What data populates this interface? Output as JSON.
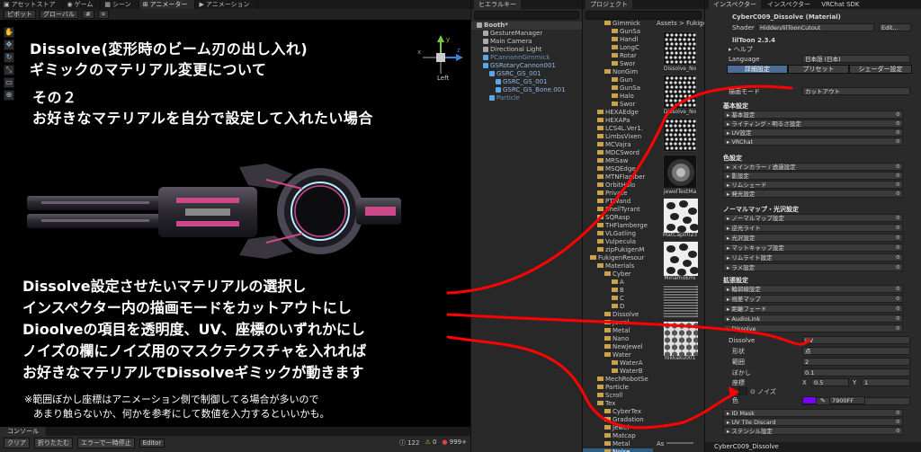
{
  "topbar": {
    "tabs": [
      "アセットストア",
      "ゲーム",
      "シーン",
      "アニメーター",
      "アニメーション"
    ]
  },
  "scene": {
    "toolbar": {
      "pivot": "ピボット",
      "global": "グローバル"
    },
    "gizmo_x": "x",
    "gizmo_y": "y",
    "gizmo_z": "z",
    "gizmo_label": "Left",
    "title_line1": "Dissolve(変形時のビーム刃の出し入れ)",
    "title_line2": "ギミックのマテリアル変更について",
    "part_line1": "その２",
    "part_line2": "お好きなマテリアルを自分で設定して入れたい場合",
    "steps": [
      "Dissolve設定させたいマテリアルの選択し",
      "インスペクター内の描画モードをカットアウトにし",
      "Dioolveの項目を透明度、UV、座標のいずれかにし",
      "ノイズの欄にノイズ用のマスクテクスチャを入れれば",
      "お好きなマテリアルでDissolveギミックが動きます"
    ],
    "note_line1": "※範囲ぼかし座標はアニメーション側で制御してる場合が多いので",
    "note_line2": "あまり触らないか、何かを参考にして数値を入力するといいかも。"
  },
  "console": {
    "tab": "コンソール",
    "clear": "クリア",
    "collapse": "折りたたむ",
    "error_pause": "エラーで一時停止",
    "editor": "Editor",
    "count_info": "122",
    "count_warn": "0",
    "count_error": "999+"
  },
  "hierarchy": {
    "tab": "ヒエラルキー",
    "items": [
      {
        "label": "Booth*",
        "style": "bold",
        "indent": 0
      },
      {
        "label": "GestureManager",
        "style": "normal",
        "indent": 1
      },
      {
        "label": "Main Camera",
        "style": "normal",
        "indent": 1
      },
      {
        "label": "Directional Light",
        "style": "normal",
        "indent": 1
      },
      {
        "label": "PCannonnGimmick",
        "style": "faded",
        "indent": 1
      },
      {
        "label": "GSRotaryCannon001",
        "style": "blue",
        "indent": 1
      },
      {
        "label": "GSRC_GS_001",
        "style": "blue",
        "indent": 2
      },
      {
        "label": "GSRC_GS_001",
        "style": "blue",
        "indent": 3
      },
      {
        "label": "GSRC_GS_Bone.001",
        "style": "blue",
        "indent": 3
      },
      {
        "label": "Particle",
        "style": "faded",
        "indent": 2
      }
    ]
  },
  "project": {
    "tab": "プロジェクト",
    "breadcrumb": "Assets > FukigenR",
    "tree": [
      {
        "label": "Gimmick",
        "indent": 3
      },
      {
        "label": "GunSa",
        "indent": 4
      },
      {
        "label": "Handl",
        "indent": 4
      },
      {
        "label": "LongC",
        "indent": 4
      },
      {
        "label": "Rotar",
        "indent": 4
      },
      {
        "label": "Swor",
        "indent": 4
      },
      {
        "label": "NonGim",
        "indent": 3
      },
      {
        "label": "Gun",
        "indent": 4
      },
      {
        "label": "GunSa",
        "indent": 4
      },
      {
        "label": "Halo",
        "indent": 4
      },
      {
        "label": "Swor",
        "indent": 4
      },
      {
        "label": "HEXAEdge",
        "indent": 2
      },
      {
        "label": "HEXAPa",
        "indent": 2
      },
      {
        "label": "LCS4L.Ver1.",
        "indent": 2
      },
      {
        "label": "LimbsVixen",
        "indent": 2
      },
      {
        "label": "MCVajra",
        "indent": 2
      },
      {
        "label": "MDCSword",
        "indent": 2
      },
      {
        "label": "MRSaw",
        "indent": 2
      },
      {
        "label": "MSQEdge",
        "indent": 2
      },
      {
        "label": "MTNFlamber",
        "indent": 2
      },
      {
        "label": "OrbitHalo",
        "indent": 2
      },
      {
        "label": "Private",
        "indent": 2
      },
      {
        "label": "PTWand",
        "indent": 2
      },
      {
        "label": "ShellTyrant",
        "indent": 2
      },
      {
        "label": "SQRasp",
        "indent": 2
      },
      {
        "label": "THFlamberge",
        "indent": 2
      },
      {
        "label": "VLGatling",
        "indent": 2
      },
      {
        "label": "Vulpecula",
        "indent": 2
      },
      {
        "label": "zipFukigenM",
        "indent": 2
      },
      {
        "label": "FukigenResour",
        "indent": 1
      },
      {
        "label": "Materials",
        "indent": 2
      },
      {
        "label": "Cyber",
        "indent": 3
      },
      {
        "label": "A",
        "indent": 4
      },
      {
        "label": "B",
        "indent": 4
      },
      {
        "label": "C",
        "indent": 4
      },
      {
        "label": "D",
        "indent": 4
      },
      {
        "label": "Dissolve",
        "indent": 3
      },
      {
        "label": "Jewel",
        "indent": 3
      },
      {
        "label": "Metal",
        "indent": 3
      },
      {
        "label": "Nano",
        "indent": 3
      },
      {
        "label": "NewJewel",
        "indent": 3
      },
      {
        "label": "Water",
        "indent": 3
      },
      {
        "label": "WaterA",
        "indent": 4
      },
      {
        "label": "WaterB",
        "indent": 4
      },
      {
        "label": "MechRobotSe",
        "indent": 2
      },
      {
        "label": "Particle",
        "indent": 2
      },
      {
        "label": "Scroll",
        "indent": 2
      },
      {
        "label": "Tex",
        "indent": 2
      },
      {
        "label": "CyberTex",
        "indent": 3
      },
      {
        "label": "Gradation",
        "indent": 3
      },
      {
        "label": "Jewel",
        "indent": 3
      },
      {
        "label": "Matcap",
        "indent": 3
      },
      {
        "label": "Metal",
        "indent": 3
      },
      {
        "label": "Noise",
        "indent": 3,
        "selected": true
      },
      {
        "label": "WaterTex",
        "indent": 3
      },
      {
        "label": "Trail",
        "indent": 2
      }
    ],
    "assets": [
      {
        "label": "Dissolve_No",
        "pattern": "dots"
      },
      {
        "label": "Dissolve_No",
        "pattern": "dots"
      },
      {
        "label": "",
        "pattern": "dots"
      },
      {
        "label": "jewelTestMa",
        "pattern": "swirl"
      },
      {
        "label": "MatCap0023",
        "pattern": "cells"
      },
      {
        "label": "MinamoEmi",
        "pattern": "cells"
      },
      {
        "label": "",
        "pattern": "lines"
      },
      {
        "label": "rokkaku001",
        "pattern": "hex"
      }
    ],
    "slider_label": "As"
  },
  "inspector": {
    "tabs": [
      "インスペクター",
      "インスペクター",
      "VRChat SDK"
    ],
    "material_name": "CyberC009_Dissolve (Material)",
    "shader_label": "Shader",
    "shader_value": "Hidden/lilToonCutout",
    "edit_label": "Edit...",
    "liltoon_version": "lilToon 2.3.4",
    "help": "ヘルプ",
    "language_label": "Language",
    "language_value": "日本語 (日本)",
    "mode_buttons": [
      "詳細設定",
      "プリセット",
      "シェーダー設定"
    ],
    "render_mode_label": "描画モード",
    "render_mode_value": "カットアウト",
    "section_basic": "基本設定",
    "basic_items": [
      "基本設定",
      "ライティング・明るさ設定",
      "UV設定",
      "VRChat"
    ],
    "section_color": "色設定",
    "color_items": [
      "メインカラー / 透過設定",
      "影設定",
      "リムシェード",
      "発光設定"
    ],
    "section_normal": "ノーマルマップ・光沢設定",
    "normal_items": [
      "ノーマルマップ設定",
      "逆光ライト",
      "光沢設定",
      "マットキャップ設定",
      "リムライト設定",
      "ラメ設定"
    ],
    "section_ext": "拡張設定",
    "ext_items": [
      "輪郭線設定",
      "視差マップ",
      "距離フェード",
      "AudioLink",
      "Dissolve"
    ],
    "dissolve_label": "Dissolve",
    "dissolve_value": "UV",
    "shape_label": "形状",
    "shape_value": "点",
    "range_label": "範囲",
    "range_value": "2",
    "blur_label": "ぼかし",
    "blur_value": "0.1",
    "coord_label": "座標",
    "coord_x_label": "X",
    "coord_x_value": "0.5",
    "coord_y_label": "Y",
    "coord_y_value": "1",
    "noise_label": "ノイズ",
    "noise_strength": "0.1",
    "color_label": "色",
    "color_hex": "7900FF",
    "after_items": [
      "ID Mask",
      "UV Tile Discard",
      "ステンシル設定"
    ],
    "footer": "CyberC009_Dissolve",
    "accent_color": "#7900FF"
  },
  "colors": {
    "annotation": "#ff0000",
    "selection": "#2c5d87"
  }
}
